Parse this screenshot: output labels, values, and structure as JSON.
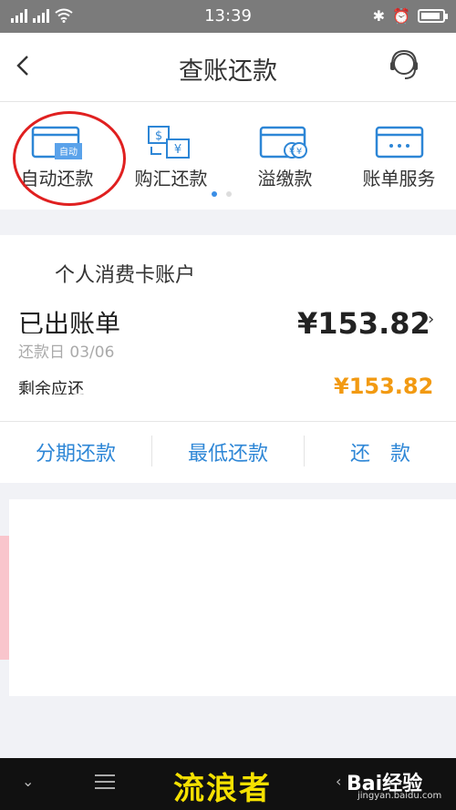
{
  "status_bar": {
    "time": "13:39"
  },
  "nav": {
    "title": "查账还款"
  },
  "quick_actions": [
    {
      "label": "自动还款",
      "badge": "自动"
    },
    {
      "label": "购汇还款"
    },
    {
      "label": "溢缴款"
    },
    {
      "label": "账单服务"
    }
  ],
  "account": {
    "name": "个人消费卡账户",
    "bill_title": "已出账单",
    "bill_amount": "¥153.82",
    "due_date": "还款日 03/06",
    "remaining_label": "剩余应还",
    "remaining_amount": "¥153.82"
  },
  "actions": {
    "installment": "分期还款",
    "minimum": "最低还款",
    "repay": "还　款"
  },
  "watermark": {
    "text": "流浪者",
    "baidu": "Bai经验",
    "baidu_url": "jingyan.baidu.com"
  },
  "colors": {
    "accent": "#2d86d6",
    "orange": "#f29a12",
    "annotation": "#e02020"
  }
}
